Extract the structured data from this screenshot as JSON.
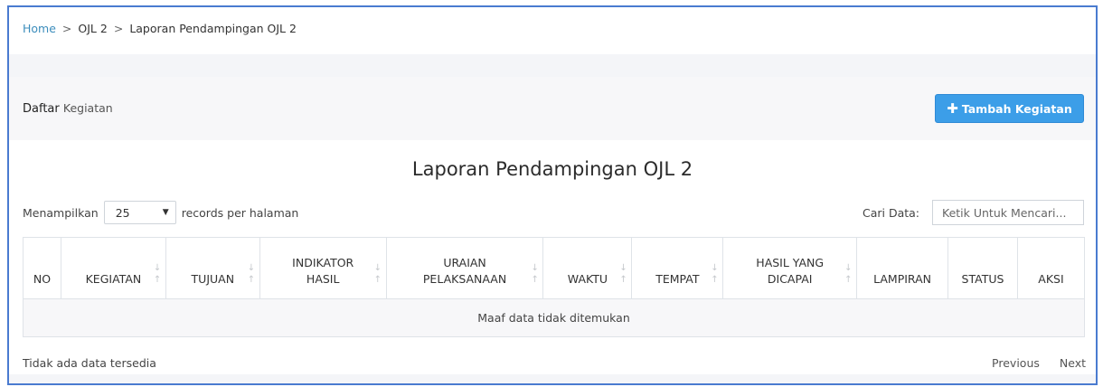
{
  "breadcrumb": {
    "home": "Home",
    "sep": ">",
    "level1": "OJL 2",
    "current": "Laporan Pendampingan OJL 2"
  },
  "panel": {
    "title_strong": "Daftar",
    "title_light": "Kegiatan",
    "add_button": "Tambah Kegiatan",
    "add_icon": "plus-icon"
  },
  "report_title": "Laporan Pendampingan OJL 2",
  "length": {
    "prefix": "Menampilkan",
    "value": "25",
    "suffix": "records per halaman"
  },
  "search": {
    "label": "Cari Data:",
    "placeholder": "Ketik Untuk Mencari..."
  },
  "table": {
    "columns": [
      {
        "l1": "",
        "l2": "NO",
        "sortable": false
      },
      {
        "l1": "",
        "l2": "KEGIATAN",
        "sortable": true
      },
      {
        "l1": "",
        "l2": "TUJUAN",
        "sortable": true
      },
      {
        "l1": "INDIKATOR",
        "l2": "HASIL",
        "sortable": true
      },
      {
        "l1": "URAIAN",
        "l2": "PELAKSANAAN",
        "sortable": true
      },
      {
        "l1": "",
        "l2": "WAKTU",
        "sortable": true
      },
      {
        "l1": "",
        "l2": "TEMPAT",
        "sortable": true
      },
      {
        "l1": "HASIL YANG",
        "l2": "DICAPAI",
        "sortable": true
      },
      {
        "l1": "",
        "l2": "LAMPIRAN",
        "sortable": false
      },
      {
        "l1": "",
        "l2": "STATUS",
        "sortable": false
      },
      {
        "l1": "",
        "l2": "AKSI",
        "sortable": false
      }
    ],
    "empty_message": "Maaf data tidak ditemukan"
  },
  "footer": {
    "info": "Tidak ada data tersedia",
    "previous": "Previous",
    "next": "Next"
  },
  "colors": {
    "accent": "#3c9ee8",
    "link": "#3c8dbc",
    "frame": "#4a7bd0"
  }
}
